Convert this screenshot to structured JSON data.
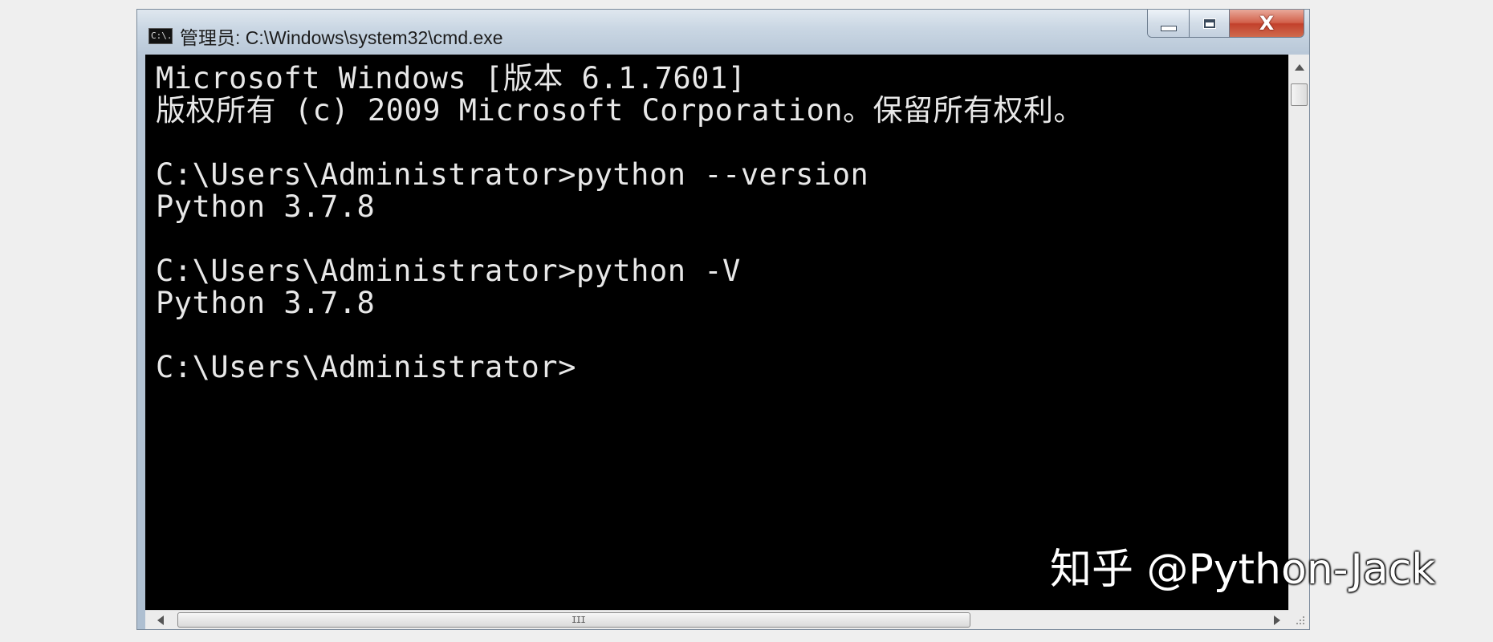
{
  "window": {
    "title": "管理员: C:\\Windows\\system32\\cmd.exe",
    "icon": "cmd-icon",
    "icon_text": "C:\\."
  },
  "caption_buttons": {
    "minimize": "minimize-icon",
    "maximize": "maximize-icon",
    "close": "close-icon",
    "close_glyph": "X"
  },
  "console": {
    "lines": [
      "Microsoft Windows [版本 6.1.7601]",
      "版权所有 (c) 2009 Microsoft Corporation。保留所有权利。",
      "",
      "C:\\Users\\Administrator>python --version",
      "Python 3.7.8",
      "",
      "C:\\Users\\Administrator>python -V",
      "Python 3.7.8",
      "",
      "C:\\Users\\Administrator>"
    ],
    "background": "#000000",
    "foreground": "#e8e8e8"
  },
  "scrollbar": {
    "horizontal_grip": "III"
  },
  "watermark": {
    "text": "知乎 @Python-Jack"
  }
}
